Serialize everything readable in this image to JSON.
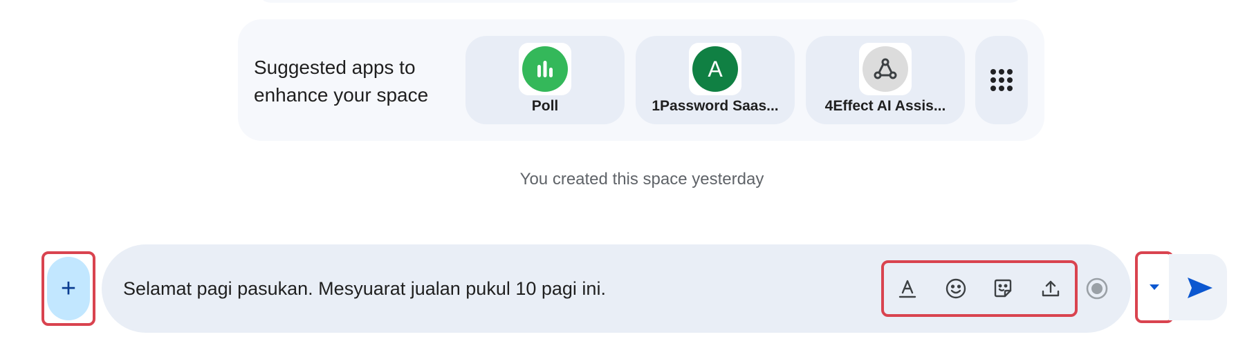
{
  "suggested": {
    "line1": "Suggested apps to",
    "line2": "enhance your space",
    "apps": [
      {
        "name": "Poll",
        "icon": "poll-icon",
        "color": "#34b85a"
      },
      {
        "name": "1Password Saas...",
        "icon_letter": "A",
        "icon": "letter-a-icon",
        "color": "#108043"
      },
      {
        "name": "4Effect AI Assis...",
        "icon": "webhook-icon",
        "color": "#dcdcdc"
      }
    ],
    "more_icon": "grid-dots-icon"
  },
  "created_note": "You created this space yesterday",
  "composer": {
    "plus_label": "+",
    "message_value": "Selamat pagi pasukan. Mesyuarat jualan pukul 10 pagi ini.",
    "tools": [
      "format-text-icon",
      "emoji-icon",
      "sticker-icon",
      "upload-icon",
      "record-icon"
    ],
    "dropdown_icon": "caret-down-icon",
    "send_icon": "send-icon"
  },
  "colors": {
    "plus_bg": "#c2e7ff",
    "compose_bg": "#e9eef6",
    "highlight": "#d9434f",
    "send": "#0b57d0"
  }
}
